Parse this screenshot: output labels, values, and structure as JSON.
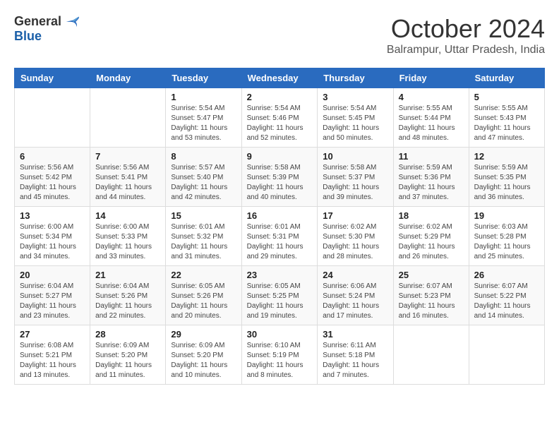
{
  "logo": {
    "general": "General",
    "blue": "Blue"
  },
  "header": {
    "month": "October 2024",
    "location": "Balrampur, Uttar Pradesh, India"
  },
  "weekdays": [
    "Sunday",
    "Monday",
    "Tuesday",
    "Wednesday",
    "Thursday",
    "Friday",
    "Saturday"
  ],
  "weeks": [
    [
      {
        "day": "",
        "info": ""
      },
      {
        "day": "",
        "info": ""
      },
      {
        "day": "1",
        "info": "Sunrise: 5:54 AM\nSunset: 5:47 PM\nDaylight: 11 hours and 53 minutes."
      },
      {
        "day": "2",
        "info": "Sunrise: 5:54 AM\nSunset: 5:46 PM\nDaylight: 11 hours and 52 minutes."
      },
      {
        "day": "3",
        "info": "Sunrise: 5:54 AM\nSunset: 5:45 PM\nDaylight: 11 hours and 50 minutes."
      },
      {
        "day": "4",
        "info": "Sunrise: 5:55 AM\nSunset: 5:44 PM\nDaylight: 11 hours and 48 minutes."
      },
      {
        "day": "5",
        "info": "Sunrise: 5:55 AM\nSunset: 5:43 PM\nDaylight: 11 hours and 47 minutes."
      }
    ],
    [
      {
        "day": "6",
        "info": "Sunrise: 5:56 AM\nSunset: 5:42 PM\nDaylight: 11 hours and 45 minutes."
      },
      {
        "day": "7",
        "info": "Sunrise: 5:56 AM\nSunset: 5:41 PM\nDaylight: 11 hours and 44 minutes."
      },
      {
        "day": "8",
        "info": "Sunrise: 5:57 AM\nSunset: 5:40 PM\nDaylight: 11 hours and 42 minutes."
      },
      {
        "day": "9",
        "info": "Sunrise: 5:58 AM\nSunset: 5:39 PM\nDaylight: 11 hours and 40 minutes."
      },
      {
        "day": "10",
        "info": "Sunrise: 5:58 AM\nSunset: 5:37 PM\nDaylight: 11 hours and 39 minutes."
      },
      {
        "day": "11",
        "info": "Sunrise: 5:59 AM\nSunset: 5:36 PM\nDaylight: 11 hours and 37 minutes."
      },
      {
        "day": "12",
        "info": "Sunrise: 5:59 AM\nSunset: 5:35 PM\nDaylight: 11 hours and 36 minutes."
      }
    ],
    [
      {
        "day": "13",
        "info": "Sunrise: 6:00 AM\nSunset: 5:34 PM\nDaylight: 11 hours and 34 minutes."
      },
      {
        "day": "14",
        "info": "Sunrise: 6:00 AM\nSunset: 5:33 PM\nDaylight: 11 hours and 33 minutes."
      },
      {
        "day": "15",
        "info": "Sunrise: 6:01 AM\nSunset: 5:32 PM\nDaylight: 11 hours and 31 minutes."
      },
      {
        "day": "16",
        "info": "Sunrise: 6:01 AM\nSunset: 5:31 PM\nDaylight: 11 hours and 29 minutes."
      },
      {
        "day": "17",
        "info": "Sunrise: 6:02 AM\nSunset: 5:30 PM\nDaylight: 11 hours and 28 minutes."
      },
      {
        "day": "18",
        "info": "Sunrise: 6:02 AM\nSunset: 5:29 PM\nDaylight: 11 hours and 26 minutes."
      },
      {
        "day": "19",
        "info": "Sunrise: 6:03 AM\nSunset: 5:28 PM\nDaylight: 11 hours and 25 minutes."
      }
    ],
    [
      {
        "day": "20",
        "info": "Sunrise: 6:04 AM\nSunset: 5:27 PM\nDaylight: 11 hours and 23 minutes."
      },
      {
        "day": "21",
        "info": "Sunrise: 6:04 AM\nSunset: 5:26 PM\nDaylight: 11 hours and 22 minutes."
      },
      {
        "day": "22",
        "info": "Sunrise: 6:05 AM\nSunset: 5:26 PM\nDaylight: 11 hours and 20 minutes."
      },
      {
        "day": "23",
        "info": "Sunrise: 6:05 AM\nSunset: 5:25 PM\nDaylight: 11 hours and 19 minutes."
      },
      {
        "day": "24",
        "info": "Sunrise: 6:06 AM\nSunset: 5:24 PM\nDaylight: 11 hours and 17 minutes."
      },
      {
        "day": "25",
        "info": "Sunrise: 6:07 AM\nSunset: 5:23 PM\nDaylight: 11 hours and 16 minutes."
      },
      {
        "day": "26",
        "info": "Sunrise: 6:07 AM\nSunset: 5:22 PM\nDaylight: 11 hours and 14 minutes."
      }
    ],
    [
      {
        "day": "27",
        "info": "Sunrise: 6:08 AM\nSunset: 5:21 PM\nDaylight: 11 hours and 13 minutes."
      },
      {
        "day": "28",
        "info": "Sunrise: 6:09 AM\nSunset: 5:20 PM\nDaylight: 11 hours and 11 minutes."
      },
      {
        "day": "29",
        "info": "Sunrise: 6:09 AM\nSunset: 5:20 PM\nDaylight: 11 hours and 10 minutes."
      },
      {
        "day": "30",
        "info": "Sunrise: 6:10 AM\nSunset: 5:19 PM\nDaylight: 11 hours and 8 minutes."
      },
      {
        "day": "31",
        "info": "Sunrise: 6:11 AM\nSunset: 5:18 PM\nDaylight: 11 hours and 7 minutes."
      },
      {
        "day": "",
        "info": ""
      },
      {
        "day": "",
        "info": ""
      }
    ]
  ]
}
